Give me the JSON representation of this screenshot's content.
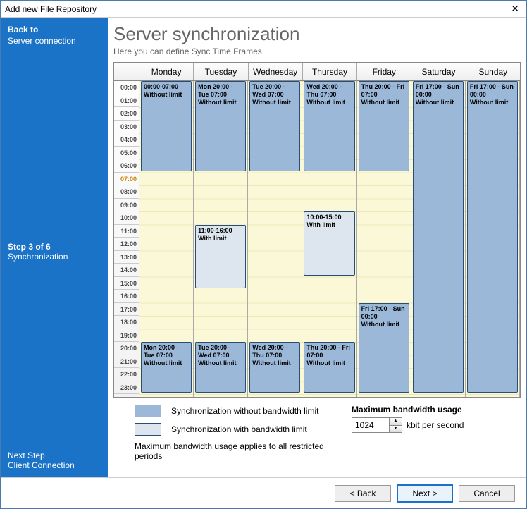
{
  "window": {
    "title": "Add new File Repository"
  },
  "sidebar": {
    "back_label": "Back to",
    "back_target": "Server connection",
    "step_title": "Step 3 of 6",
    "step_name": "Synchronization",
    "next_label": "Next Step",
    "next_target": "Client Connection"
  },
  "heading": {
    "title": "Server synchronization",
    "subtitle": "Here you can define Sync Time Frames."
  },
  "calendar": {
    "days": [
      "Monday",
      "Tuesday",
      "Wednesday",
      "Thursday",
      "Friday",
      "Saturday",
      "Sunday"
    ],
    "hours": [
      "00:00",
      "01:00",
      "02:00",
      "03:00",
      "04:00",
      "05:00",
      "06:00",
      "07:00",
      "08:00",
      "09:00",
      "10:00",
      "11:00",
      "12:00",
      "13:00",
      "14:00",
      "15:00",
      "16:00",
      "17:00",
      "18:00",
      "19:00",
      "20:00",
      "21:00",
      "22:00",
      "23:00"
    ],
    "now_hour": 7,
    "events": [
      {
        "day": 0,
        "start": 0,
        "end": 7,
        "type": "nolimit",
        "time": "00:00-07:00",
        "label": "Without limit"
      },
      {
        "day": 0,
        "start": 20,
        "end": 24,
        "type": "nolimit",
        "time": "Mon 20:00 - Tue 07:00",
        "label": "Without limit"
      },
      {
        "day": 1,
        "start": 0,
        "end": 7,
        "type": "nolimit",
        "time": "Mon 20:00 - Tue 07:00",
        "label": "Without limit"
      },
      {
        "day": 1,
        "start": 11,
        "end": 16,
        "type": "withlimit",
        "time": "11:00-16:00",
        "label": "With limit"
      },
      {
        "day": 1,
        "start": 20,
        "end": 24,
        "type": "nolimit",
        "time": "Tue 20:00 - Wed 07:00",
        "label": "Without limit"
      },
      {
        "day": 2,
        "start": 0,
        "end": 7,
        "type": "nolimit",
        "time": "Tue 20:00 - Wed 07:00",
        "label": "Without limit"
      },
      {
        "day": 2,
        "start": 20,
        "end": 24,
        "type": "nolimit",
        "time": "Wed 20:00 - Thu 07:00",
        "label": "Without limit"
      },
      {
        "day": 3,
        "start": 0,
        "end": 7,
        "type": "nolimit",
        "time": "Wed 20:00 - Thu 07:00",
        "label": "Without limit"
      },
      {
        "day": 3,
        "start": 10,
        "end": 15,
        "type": "withlimit",
        "time": "10:00-15:00",
        "label": "With limit"
      },
      {
        "day": 3,
        "start": 20,
        "end": 24,
        "type": "nolimit",
        "time": "Thu 20:00 - Fri 07:00",
        "label": "Without limit"
      },
      {
        "day": 4,
        "start": 0,
        "end": 7,
        "type": "nolimit",
        "time": "Thu 20:00 - Fri 07:00",
        "label": "Without limit"
      },
      {
        "day": 4,
        "start": 17,
        "end": 24,
        "type": "nolimit",
        "time": "Fri 17:00 - Sun 00:00",
        "label": "Without limit"
      },
      {
        "day": 5,
        "start": 0,
        "end": 24,
        "type": "nolimit",
        "time": "Fri 17:00 - Sun 00:00",
        "label": "Without limit"
      },
      {
        "day": 6,
        "start": 0,
        "end": 24,
        "type": "nolimit",
        "time": "Fri 17:00 - Sun 00:00",
        "label": "Without limit"
      }
    ]
  },
  "legend": {
    "nolimit": "Synchronization without bandwidth limit",
    "withlimit": "Synchronization with bandwidth limit",
    "note": "Maximum bandwidth usage applies to all restricted periods",
    "max_label": "Maximum bandwidth usage",
    "value": "1024",
    "unit": "kbit per second"
  },
  "footer": {
    "back": "< Back",
    "next": "Next >",
    "cancel": "Cancel"
  }
}
